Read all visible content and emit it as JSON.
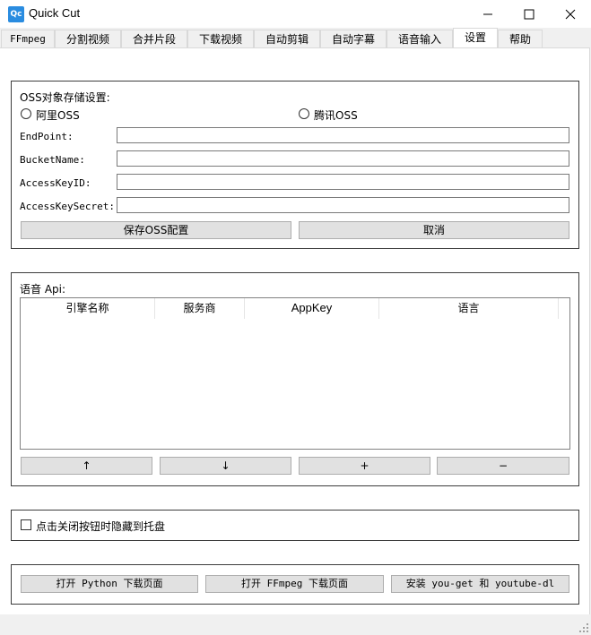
{
  "window": {
    "app_icon": "Qc",
    "title": "Quick Cut",
    "controls": [
      "minimize-icon",
      "maximize-icon",
      "close-icon"
    ]
  },
  "tabs": [
    {
      "label": "FFmpeg"
    },
    {
      "label": "分割视频"
    },
    {
      "label": "合并片段"
    },
    {
      "label": "下载视频"
    },
    {
      "label": "自动剪辑"
    },
    {
      "label": "自动字幕"
    },
    {
      "label": "语音输入"
    },
    {
      "label": "设置",
      "active": true
    },
    {
      "label": "帮助"
    }
  ],
  "oss": {
    "group_title": "OSS对象存储设置:",
    "radio_aliyun": "阿里OSS",
    "radio_tencent": "腾讯OSS",
    "selected": "none",
    "fields": [
      {
        "label": "EndPoint:",
        "value": ""
      },
      {
        "label": "BucketName:",
        "value": ""
      },
      {
        "label": "AccessKeyID:",
        "value": ""
      },
      {
        "label": "AccessKeySecret:",
        "value": ""
      }
    ],
    "save_button": "保存OSS配置",
    "cancel_button": "取消"
  },
  "speech_api": {
    "group_title": "语音 Api:",
    "columns": [
      "引擎名称",
      "服务商",
      "AppKey",
      "语言"
    ],
    "rows": [],
    "up_button": "↑",
    "down_button": "↓",
    "add_button": "+",
    "remove_button": "−"
  },
  "tray": {
    "checkbox_label": "点击关闭按钮时隐藏到托盘",
    "checked": false
  },
  "links": {
    "python_button": "打开 Python 下载页面",
    "ffmpeg_button": "打开 FFmpeg 下载页面",
    "install_button": "安装 you-get 和 youtube-dl"
  }
}
